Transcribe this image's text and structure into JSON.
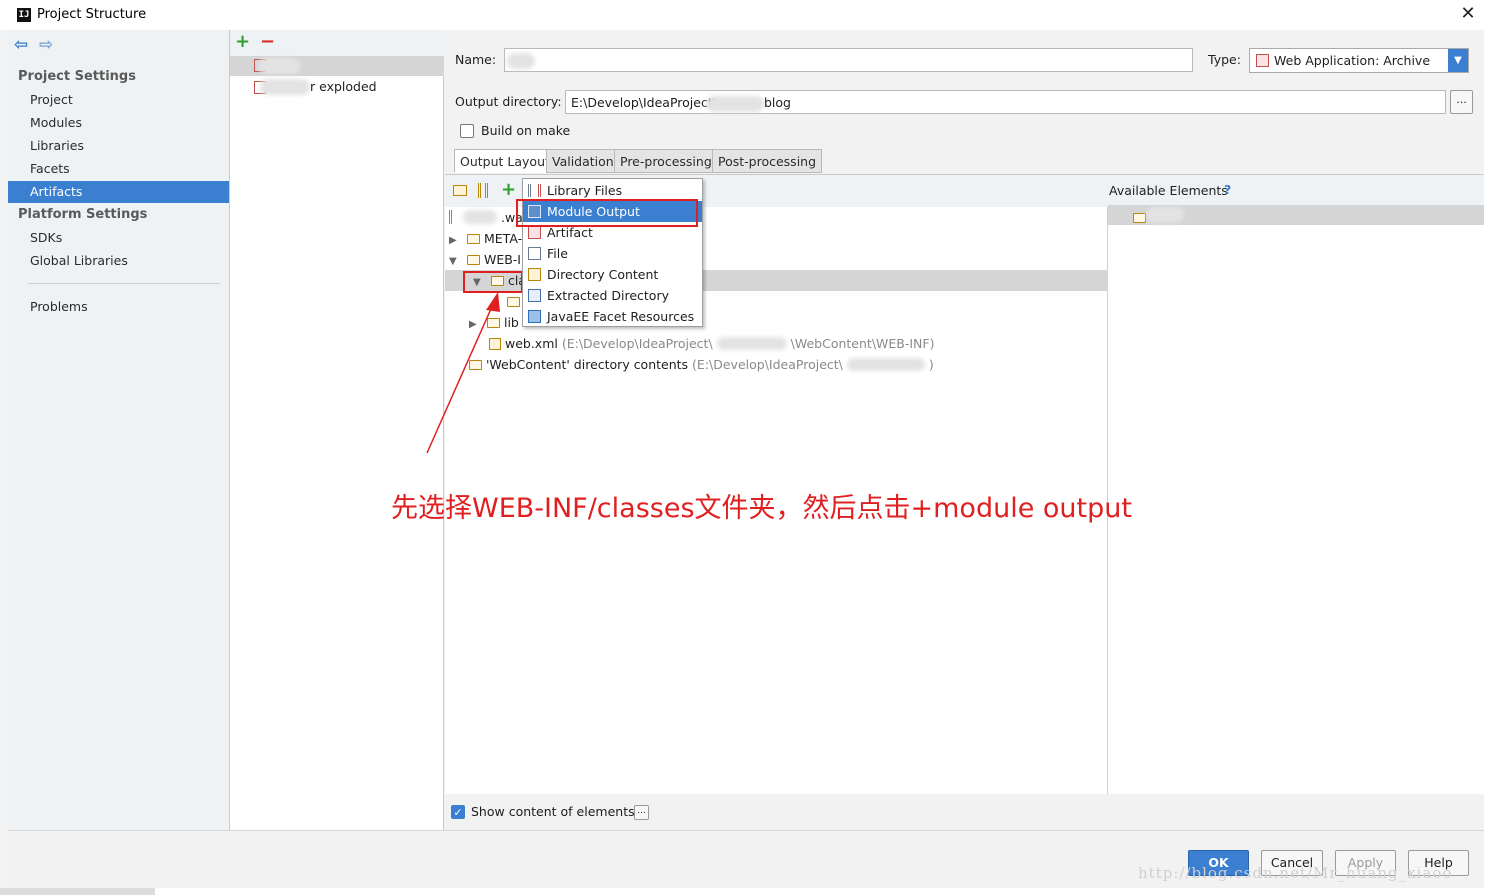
{
  "window": {
    "title": "Project Structure",
    "close_glyph": "✕"
  },
  "settings": {
    "back_glyph": "⇦",
    "forward_glyph": "⇨",
    "project_settings_title": "Project Settings",
    "project_items": [
      "Project",
      "Modules",
      "Libraries",
      "Facets",
      "Artifacts"
    ],
    "selected_item": "Artifacts",
    "platform_settings_title": "Platform Settings",
    "platform_items": [
      "SDKs",
      "Global Libraries"
    ],
    "problems_label": "Problems"
  },
  "artifacts": {
    "add_glyph": "+",
    "remove_glyph": "−",
    "items": [
      "",
      "r exploded"
    ]
  },
  "config": {
    "name_label": "Name:",
    "name_value": "",
    "type_label": "Type:",
    "type_value": "Web Application: Archive",
    "output_dir_label": "Output directory:",
    "output_dir_value_prefix": "E:\\Develop\\IdeaProject\\",
    "output_dir_value_suffix": "blog",
    "browse_label": "...",
    "build_on_make_label": "Build on make",
    "build_on_make_checked": false,
    "tabs": [
      "Output Layout",
      "Validation",
      "Pre-processing",
      "Post-processing"
    ],
    "selected_tab": "Output Layout"
  },
  "layout_tree": {
    "rows": [
      {
        "text": ".war",
        "hint": ""
      },
      {
        "text": "META-",
        "hint": ""
      },
      {
        "text": "WEB-I",
        "hint": ""
      },
      {
        "text": "cla",
        "hint": ""
      },
      {
        "text": "",
        "hint": ""
      },
      {
        "text": "lib",
        "hint": ""
      },
      {
        "text": "web.xml",
        "hint": "(E:\\Develop\\IdeaProject\\"
      },
      {
        "text": "'WebContent' directory contents",
        "hint": "(E:\\Develop\\IdeaProject\\"
      }
    ],
    "web_xml_hint_suffix": "\\WebContent\\WEB-INF)",
    "webcontent_hint_suffix": ")"
  },
  "available": {
    "title": "Available Elements",
    "help_glyph": "?"
  },
  "popup_menu": {
    "items": [
      "Library Files",
      "Module Output",
      "Artifact",
      "File",
      "Directory Content",
      "Extracted Directory",
      "JavaEE Facet Resources"
    ],
    "selected": "Module Output"
  },
  "bottom": {
    "show_content_label": "Show content of elements",
    "show_content_checked": true,
    "more_label": "..."
  },
  "buttons": {
    "ok": "OK",
    "cancel": "Cancel",
    "apply": "Apply",
    "help": "Help"
  },
  "annotation": "先选择WEB-INF/classes文件夹，然后点击+module output",
  "watermark": "http://blog.csdn.net/Mr_huang_xiaoo",
  "colors": {
    "accent": "#3a7fd0",
    "annotation_red": "#e02020"
  }
}
